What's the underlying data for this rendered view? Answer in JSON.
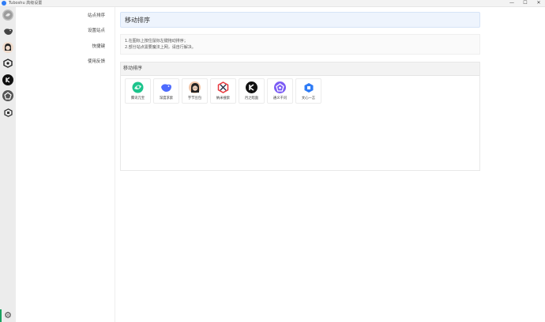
{
  "window": {
    "title": "Tuboshu  高级设置",
    "controls": {
      "minimize": "—",
      "maximize": "☐",
      "close": "✕"
    }
  },
  "rail": {
    "items": [
      {
        "name": "tencent-yuanbao-icon",
        "color": "#8a8a8a"
      },
      {
        "name": "deepseek-icon",
        "color": "#555555"
      },
      {
        "name": "doubao-icon",
        "color": "#333333"
      },
      {
        "name": "nami-icon",
        "color": "#222222"
      },
      {
        "name": "kimi-icon",
        "color": "#111111"
      },
      {
        "name": "tongyi-icon",
        "color": "#444444"
      },
      {
        "name": "wenxin-icon",
        "color": "#333333"
      }
    ],
    "settings_icon": "⚙"
  },
  "nav": {
    "items": [
      {
        "label": "站点排序"
      },
      {
        "label": "设置站点"
      },
      {
        "label": "快捷键"
      },
      {
        "label": "使用反馈"
      }
    ]
  },
  "main": {
    "title": "移动排序",
    "notes": [
      "1.在图标上按住鼠标左键拖动排序；",
      "2.部分站点需要魔法上网，请自行解决。"
    ],
    "panel_title": "移动排序",
    "tiles": [
      {
        "label": "腾讯元宝",
        "icon": "yuanbao-icon",
        "color": "#1cc48c"
      },
      {
        "label": "深度求索",
        "icon": "deepseek-icon",
        "color": "#4d6bfe"
      },
      {
        "label": "字节豆包",
        "icon": "doubao-icon",
        "color": "#f2c6a8"
      },
      {
        "label": "纳米搜索",
        "icon": "nami-icon",
        "color": "#e8373d"
      },
      {
        "label": "月之暗面",
        "icon": "kimi-icon",
        "color": "#111111"
      },
      {
        "label": "通义千问",
        "icon": "tongyi-icon",
        "color": "#7b5cf5"
      },
      {
        "label": "文心一言",
        "icon": "wenxin-icon",
        "color": "#2f7cf6"
      }
    ]
  }
}
